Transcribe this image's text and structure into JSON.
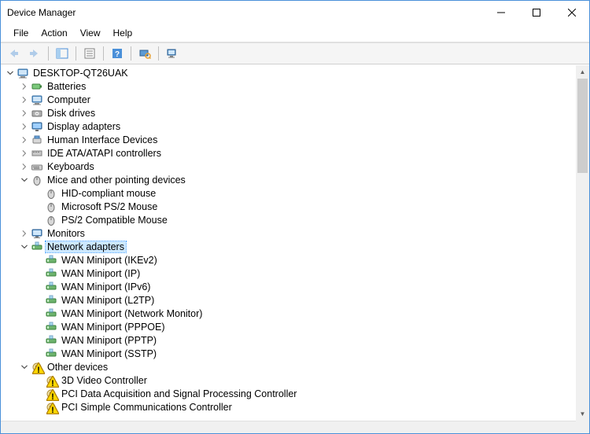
{
  "window": {
    "title": "Device Manager"
  },
  "menu": [
    "File",
    "Action",
    "View",
    "Help"
  ],
  "toolbar": {
    "back": "Back",
    "forward": "Forward",
    "show_hide": "Show/Hide Console Tree",
    "properties": "Properties",
    "help": "Help",
    "scan": "Scan for hardware changes",
    "monitor": "Devices"
  },
  "tree": [
    {
      "depth": 0,
      "expand": "open",
      "icon": "computer",
      "label": "DESKTOP-QT26UAK"
    },
    {
      "depth": 1,
      "expand": "closed",
      "icon": "battery",
      "label": "Batteries"
    },
    {
      "depth": 1,
      "expand": "closed",
      "icon": "computer",
      "label": "Computer"
    },
    {
      "depth": 1,
      "expand": "closed",
      "icon": "disk",
      "label": "Disk drives"
    },
    {
      "depth": 1,
      "expand": "closed",
      "icon": "display",
      "label": "Display adapters"
    },
    {
      "depth": 1,
      "expand": "closed",
      "icon": "hid",
      "label": "Human Interface Devices"
    },
    {
      "depth": 1,
      "expand": "closed",
      "icon": "ide",
      "label": "IDE ATA/ATAPI controllers"
    },
    {
      "depth": 1,
      "expand": "closed",
      "icon": "keyboard",
      "label": "Keyboards"
    },
    {
      "depth": 1,
      "expand": "open",
      "icon": "mouse",
      "label": "Mice and other pointing devices"
    },
    {
      "depth": 2,
      "expand": "none",
      "icon": "mouse",
      "label": "HID-compliant mouse"
    },
    {
      "depth": 2,
      "expand": "none",
      "icon": "mouse",
      "label": "Microsoft PS/2 Mouse"
    },
    {
      "depth": 2,
      "expand": "none",
      "icon": "mouse",
      "label": "PS/2 Compatible Mouse"
    },
    {
      "depth": 1,
      "expand": "closed",
      "icon": "monitor",
      "label": "Monitors"
    },
    {
      "depth": 1,
      "expand": "open",
      "icon": "network",
      "label": "Network adapters",
      "selected": true
    },
    {
      "depth": 2,
      "expand": "none",
      "icon": "network",
      "label": "WAN Miniport (IKEv2)"
    },
    {
      "depth": 2,
      "expand": "none",
      "icon": "network",
      "label": "WAN Miniport (IP)"
    },
    {
      "depth": 2,
      "expand": "none",
      "icon": "network",
      "label": "WAN Miniport (IPv6)"
    },
    {
      "depth": 2,
      "expand": "none",
      "icon": "network",
      "label": "WAN Miniport (L2TP)"
    },
    {
      "depth": 2,
      "expand": "none",
      "icon": "network",
      "label": "WAN Miniport (Network Monitor)"
    },
    {
      "depth": 2,
      "expand": "none",
      "icon": "network",
      "label": "WAN Miniport (PPPOE)"
    },
    {
      "depth": 2,
      "expand": "none",
      "icon": "network",
      "label": "WAN Miniport (PPTP)"
    },
    {
      "depth": 2,
      "expand": "none",
      "icon": "network",
      "label": "WAN Miniport (SSTP)"
    },
    {
      "depth": 1,
      "expand": "open",
      "icon": "other",
      "label": "Other devices",
      "warn": true
    },
    {
      "depth": 2,
      "expand": "none",
      "icon": "other",
      "label": "3D Video Controller",
      "warn": true
    },
    {
      "depth": 2,
      "expand": "none",
      "icon": "other",
      "label": "PCI Data Acquisition and Signal Processing Controller",
      "warn": true
    },
    {
      "depth": 2,
      "expand": "none",
      "icon": "other",
      "label": "PCI Simple Communications Controller",
      "warn": true
    }
  ]
}
